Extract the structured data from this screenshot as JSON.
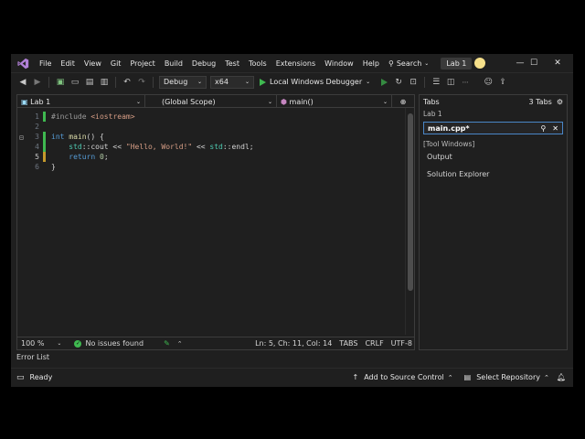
{
  "menu": {
    "items": [
      "File",
      "Edit",
      "View",
      "Git",
      "Project",
      "Build",
      "Debug",
      "Test",
      "Tools",
      "Extensions",
      "Window",
      "Help"
    ],
    "search_label": "Search",
    "solution_name": "Lab 1"
  },
  "window_controls": {
    "minimize": "—",
    "maximize": "☐",
    "close": "✕"
  },
  "toolbar": {
    "configuration": "Debug",
    "platform": "x64",
    "run_label": "Local Windows Debugger"
  },
  "editor": {
    "project_combo": "Lab 1",
    "scope_combo": "(Global Scope)",
    "member_combo": "main()",
    "lines": [
      {
        "num": "1",
        "code": "#include <iostream>"
      },
      {
        "num": "2",
        "code": ""
      },
      {
        "num": "3",
        "code": "int main() {"
      },
      {
        "num": "4",
        "code": "    std::cout << \"Hello, World!\" << std::endl;"
      },
      {
        "num": "5",
        "code": "    return 0;"
      },
      {
        "num": "6",
        "code": "}"
      }
    ],
    "zoom": "100 %",
    "issues": "No issues found",
    "position": "Ln: 5, Ch: 11, Col: 14",
    "indent": "TABS",
    "line_ending": "CRLF",
    "encoding": "UTF-8"
  },
  "tabs_panel": {
    "title": "Tabs",
    "count": "3 Tabs",
    "group_label": "Lab 1",
    "active_tab": "main.cpp*",
    "tool_windows_label": "[Tool Windows]",
    "tool_windows": [
      "Output",
      "Solution Explorer"
    ]
  },
  "bottom": {
    "error_list": "Error List",
    "status": "Ready",
    "source_control": "Add to Source Control",
    "repository": "Select Repository"
  },
  "colors": {
    "accent": "#4a86c7",
    "success": "#3fb950",
    "modified": "#c49a2c"
  }
}
